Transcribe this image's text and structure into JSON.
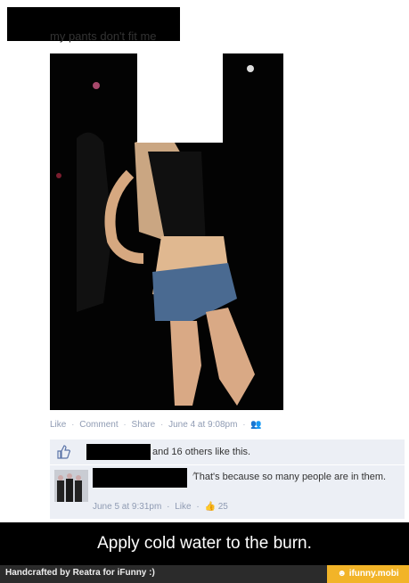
{
  "post": {
    "text": "my pants don't fit me"
  },
  "actions": {
    "like": "Like",
    "comment": "Comment",
    "share": "Share",
    "timestamp": "June 4 at 9:08pm",
    "separator": "·"
  },
  "likes": {
    "text": "and 16 others like this."
  },
  "comment": {
    "text": "That's because so many people are in them.",
    "timestamp": "June 5 at 9:31pm",
    "like_label": "Like",
    "like_count": "25"
  },
  "caption": "Apply cold water to the burn.",
  "footer": {
    "credit": "Handcrafted by Reatra for iFunny :)",
    "brand": "ifunny.mobi"
  },
  "icons": [
    "friends-icon",
    "thumbs-up-icon",
    "remove-x-icon",
    "small-thumbs-up-icon",
    "ifunny-logo-icon"
  ]
}
